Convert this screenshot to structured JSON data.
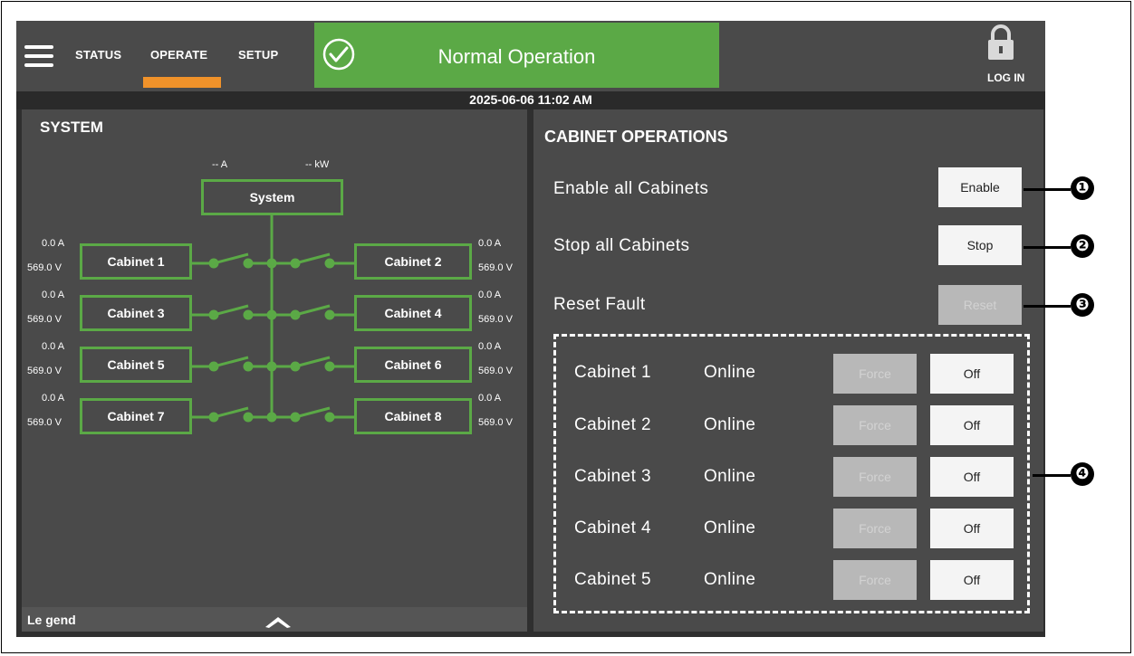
{
  "nav": {
    "tabs": [
      "STATUS",
      "OPERATE",
      "SETUP"
    ],
    "active": "OPERATE",
    "login_label": "LOG IN"
  },
  "status": {
    "text": "Normal Operation",
    "color": "#5ba946"
  },
  "datetime": "2025-06-06 11:02 AM",
  "system": {
    "title": "SYSTEM",
    "system_box": {
      "label": "System",
      "current": "-- A",
      "power": "-- kW"
    },
    "cabinets": [
      {
        "label": "Cabinet 1",
        "current": "0.0 A",
        "voltage": "569.0 V"
      },
      {
        "label": "Cabinet 2",
        "current": "0.0 A",
        "voltage": "569.0 V"
      },
      {
        "label": "Cabinet 3",
        "current": "0.0 A",
        "voltage": "569.0 V"
      },
      {
        "label": "Cabinet 4",
        "current": "0.0 A",
        "voltage": "569.0 V"
      },
      {
        "label": "Cabinet 5",
        "current": "0.0 A",
        "voltage": "569.0 V"
      },
      {
        "label": "Cabinet 6",
        "current": "0.0 A",
        "voltage": "569.0 V"
      },
      {
        "label": "Cabinet 7",
        "current": "0.0 A",
        "voltage": "569.0 V"
      },
      {
        "label": "Cabinet 8",
        "current": "0.0 A",
        "voltage": "569.0 V"
      }
    ],
    "legend_label": "Le gend"
  },
  "operations": {
    "title": "CABINET OPERATIONS",
    "enable_all": {
      "label": "Enable all Cabinets",
      "button": "Enable"
    },
    "stop_all": {
      "label": "Stop all Cabinets",
      "button": "Stop"
    },
    "reset_fault": {
      "label": "Reset Fault",
      "button": "Reset"
    },
    "cabinet_rows": [
      {
        "name": "Cabinet 1",
        "state": "Online",
        "force": "Force",
        "off": "Off"
      },
      {
        "name": "Cabinet 2",
        "state": "Online",
        "force": "Force",
        "off": "Off"
      },
      {
        "name": "Cabinet 3",
        "state": "Online",
        "force": "Force",
        "off": "Off"
      },
      {
        "name": "Cabinet 4",
        "state": "Online",
        "force": "Force",
        "off": "Off"
      },
      {
        "name": "Cabinet 5",
        "state": "Online",
        "force": "Force",
        "off": "Off"
      }
    ]
  },
  "callouts": [
    "❶",
    "❷",
    "❸",
    "❹"
  ],
  "colors": {
    "accent_green": "#5ba946",
    "active_tab_underline": "#f0922a",
    "panel": "#4a4a4a"
  }
}
